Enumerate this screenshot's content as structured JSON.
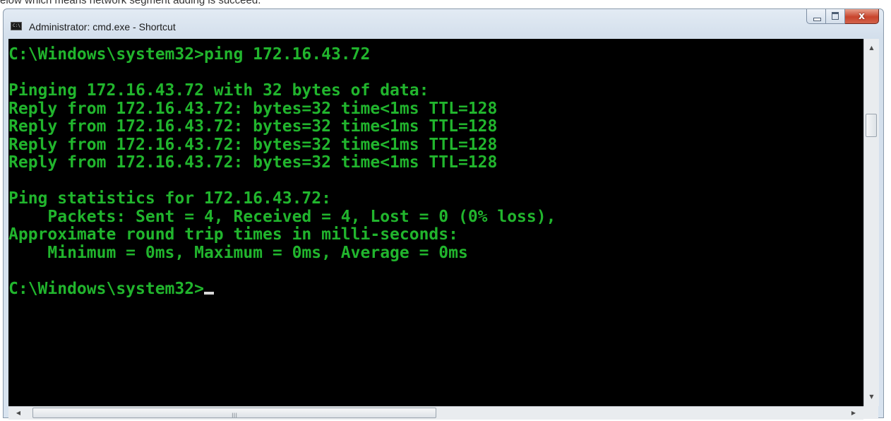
{
  "caption": "elow which means network segment adding is succeed.",
  "window": {
    "title": "Administrator: cmd.exe - Shortcut",
    "app_icon_text": "C:\\",
    "close_glyph": "x"
  },
  "console": {
    "lines": [
      "C:\\Windows\\system32>ping 172.16.43.72",
      "",
      "Pinging 172.16.43.72 with 32 bytes of data:",
      "Reply from 172.16.43.72: bytes=32 time<1ms TTL=128",
      "Reply from 172.16.43.72: bytes=32 time<1ms TTL=128",
      "Reply from 172.16.43.72: bytes=32 time<1ms TTL=128",
      "Reply from 172.16.43.72: bytes=32 time<1ms TTL=128",
      "",
      "Ping statistics for 172.16.43.72:",
      "    Packets: Sent = 4, Received = 4, Lost = 0 (0% loss),",
      "Approximate round trip times in milli-seconds:",
      "    Minimum = 0ms, Maximum = 0ms, Average = 0ms",
      "",
      "C:\\Windows\\system32>"
    ]
  },
  "scrollbars": {
    "up_arrow": "▲",
    "down_arrow": "▼",
    "left_arrow": "◀",
    "right_arrow": "▶",
    "h_grip": "III"
  },
  "colors": {
    "console_text": "#21b52d",
    "console_background": "#000000",
    "close_button": "#c8442c"
  }
}
